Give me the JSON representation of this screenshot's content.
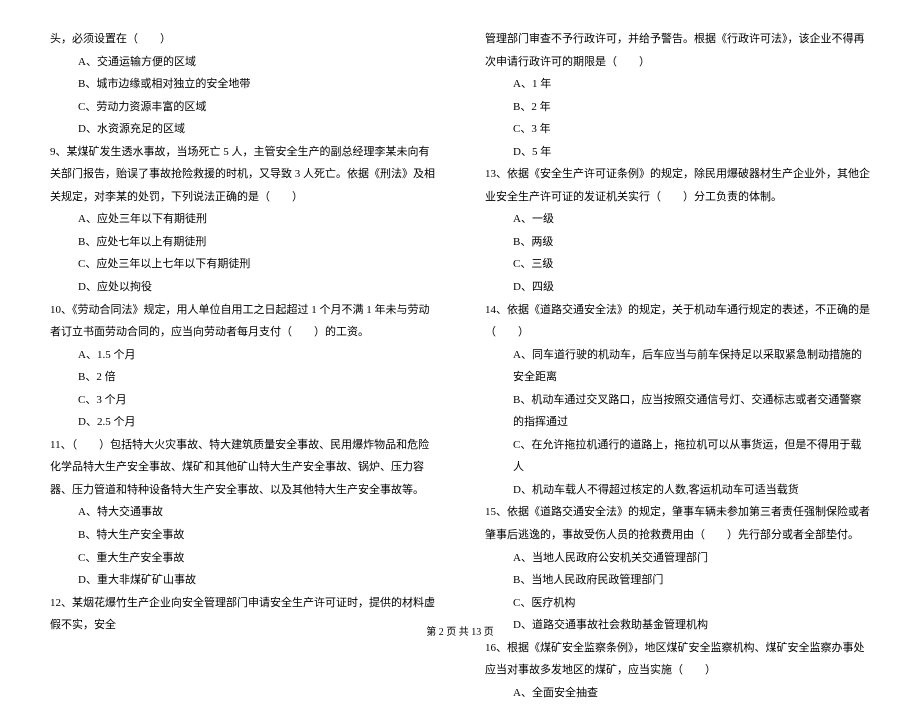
{
  "left": {
    "q_prefix_line": "头，必须设置在（　　）",
    "q_prefix_options": [
      "A、交通运输方便的区域",
      "B、城市边缘或相对独立的安全地带",
      "C、劳动力资源丰富的区域",
      "D、水资源充足的区域"
    ],
    "q9": "9、某煤矿发生透水事故，当场死亡 5 人，主管安全生产的副总经理李某未向有关部门报告，贻误了事故抢险救援的时机，又导致 3 人死亡。依据《刑法》及相关规定，对李某的处罚，下列说法正确的是（　　）",
    "q9_options": [
      "A、应处三年以下有期徒刑",
      "B、应处七年以上有期徒刑",
      "C、应处三年以上七年以下有期徒刑",
      "D、应处以拘役"
    ],
    "q10": "10、《劳动合同法》规定，用人单位自用工之日起超过 1 个月不满 1 年未与劳动者订立书面劳动合同的，应当向劳动者每月支付（　　）的工资。",
    "q10_options": [
      "A、1.5 个月",
      "B、2 倍",
      "C、3 个月",
      "D、2.5 个月"
    ],
    "q11": "11、（　　）包括特大火灾事故、特大建筑质量安全事故、民用爆炸物品和危险化学品特大生产安全事故、煤矿和其他矿山特大生产安全事故、锅炉、压力容器、压力管道和特种设备特大生产安全事故、以及其他特大生产安全事故等。",
    "q11_options": [
      "A、特大交通事故",
      "B、特大生产安全事故",
      "C、重大生产安全事故",
      "D、重大非煤矿矿山事故"
    ],
    "q12": "12、某烟花爆竹生产企业向安全管理部门申请安全生产许可证时，提供的材料虚假不实，安全"
  },
  "right": {
    "q12_cont": "管理部门审查不予行政许可，并给予警告。根据《行政许可法》，该企业不得再次申请行政许可的期限是（　　）",
    "q12_options": [
      "A、1 年",
      "B、2 年",
      "C、3 年",
      "D、5 年"
    ],
    "q13": "13、依据《安全生产许可证条例》的规定，除民用爆破器材生产企业外，其他企业安全生产许可证的发证机关实行（　　）分工负责的体制。",
    "q13_options": [
      "A、一级",
      "B、两级",
      "C、三级",
      "D、四级"
    ],
    "q14": "14、依据《道路交通安全法》的规定，关于机动车通行规定的表述，不正确的是（　　）",
    "q14_options": [
      "A、同车道行驶的机动车，后车应当与前车保持足以采取紧急制动措施的安全距离",
      "B、机动车通过交叉路口，应当按照交通信号灯、交通标志或者交通警察的指挥通过",
      "C、在允许拖拉机通行的道路上，拖拉机可以从事货运，但是不得用于载人",
      "D、机动车载人不得超过核定的人数,客运机动车可适当载货"
    ],
    "q15": "15、依据《道路交通安全法》的规定，肇事车辆未参加第三者责任强制保险或者肇事后逃逸的，事故受伤人员的抢救费用由（　　）先行部分或者全部垫付。",
    "q15_options": [
      "A、当地人民政府公安机关交通管理部门",
      "B、当地人民政府民政管理部门",
      "C、医疗机构",
      "D、道路交通事故社会救助基金管理机构"
    ],
    "q16": "16、根据《煤矿安全监察条例》，地区煤矿安全监察机构、煤矿安全监察办事处应当对事故多发地区的煤矿，应当实施（　　）",
    "q16_options": [
      "A、全面安全抽查"
    ]
  },
  "footer": "第 2 页 共 13 页"
}
